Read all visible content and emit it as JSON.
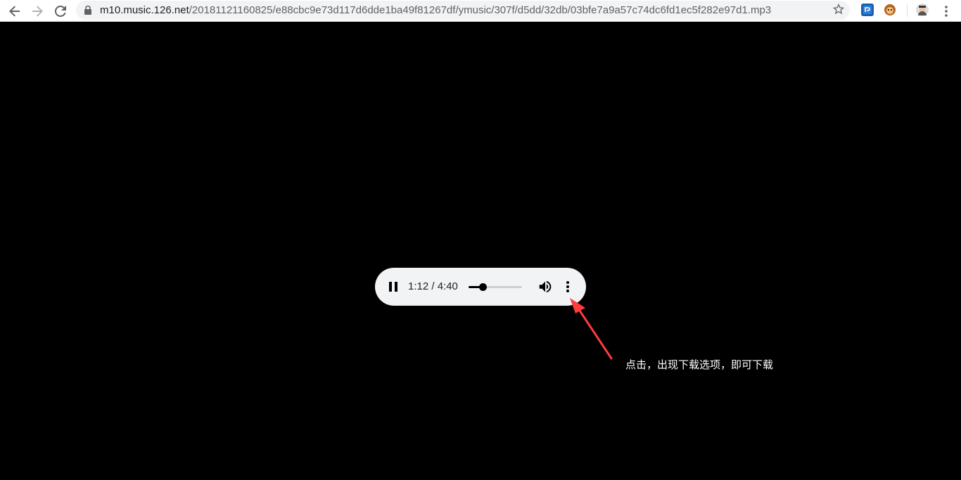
{
  "browser": {
    "url_host": "m10.music.126.net",
    "url_path": "/20181121160825/e88cbc9e73d117d6dde1ba49f81267df/ymusic/307f/d5dd/32db/03bfe7a9a57c74dc6fd1ec5f282e97d1.mp3",
    "icons": [
      "back-arrow-icon",
      "forward-arrow-icon",
      "reload-icon",
      "lock-icon",
      "bookmark-star-icon",
      "extension-icon",
      "monkey-extension-icon",
      "profile-avatar-icon",
      "menu-kebab-icon"
    ]
  },
  "player": {
    "state": "playing",
    "time_label": "1:12 / 4:40",
    "current_seconds": 72,
    "duration_seconds": 280,
    "icons": [
      "pause-icon",
      "volume-icon",
      "more-options-icon"
    ]
  },
  "annotation": {
    "text": "点击，出现下载选项，即可下载",
    "arrow_color": "#ff3b3b"
  }
}
